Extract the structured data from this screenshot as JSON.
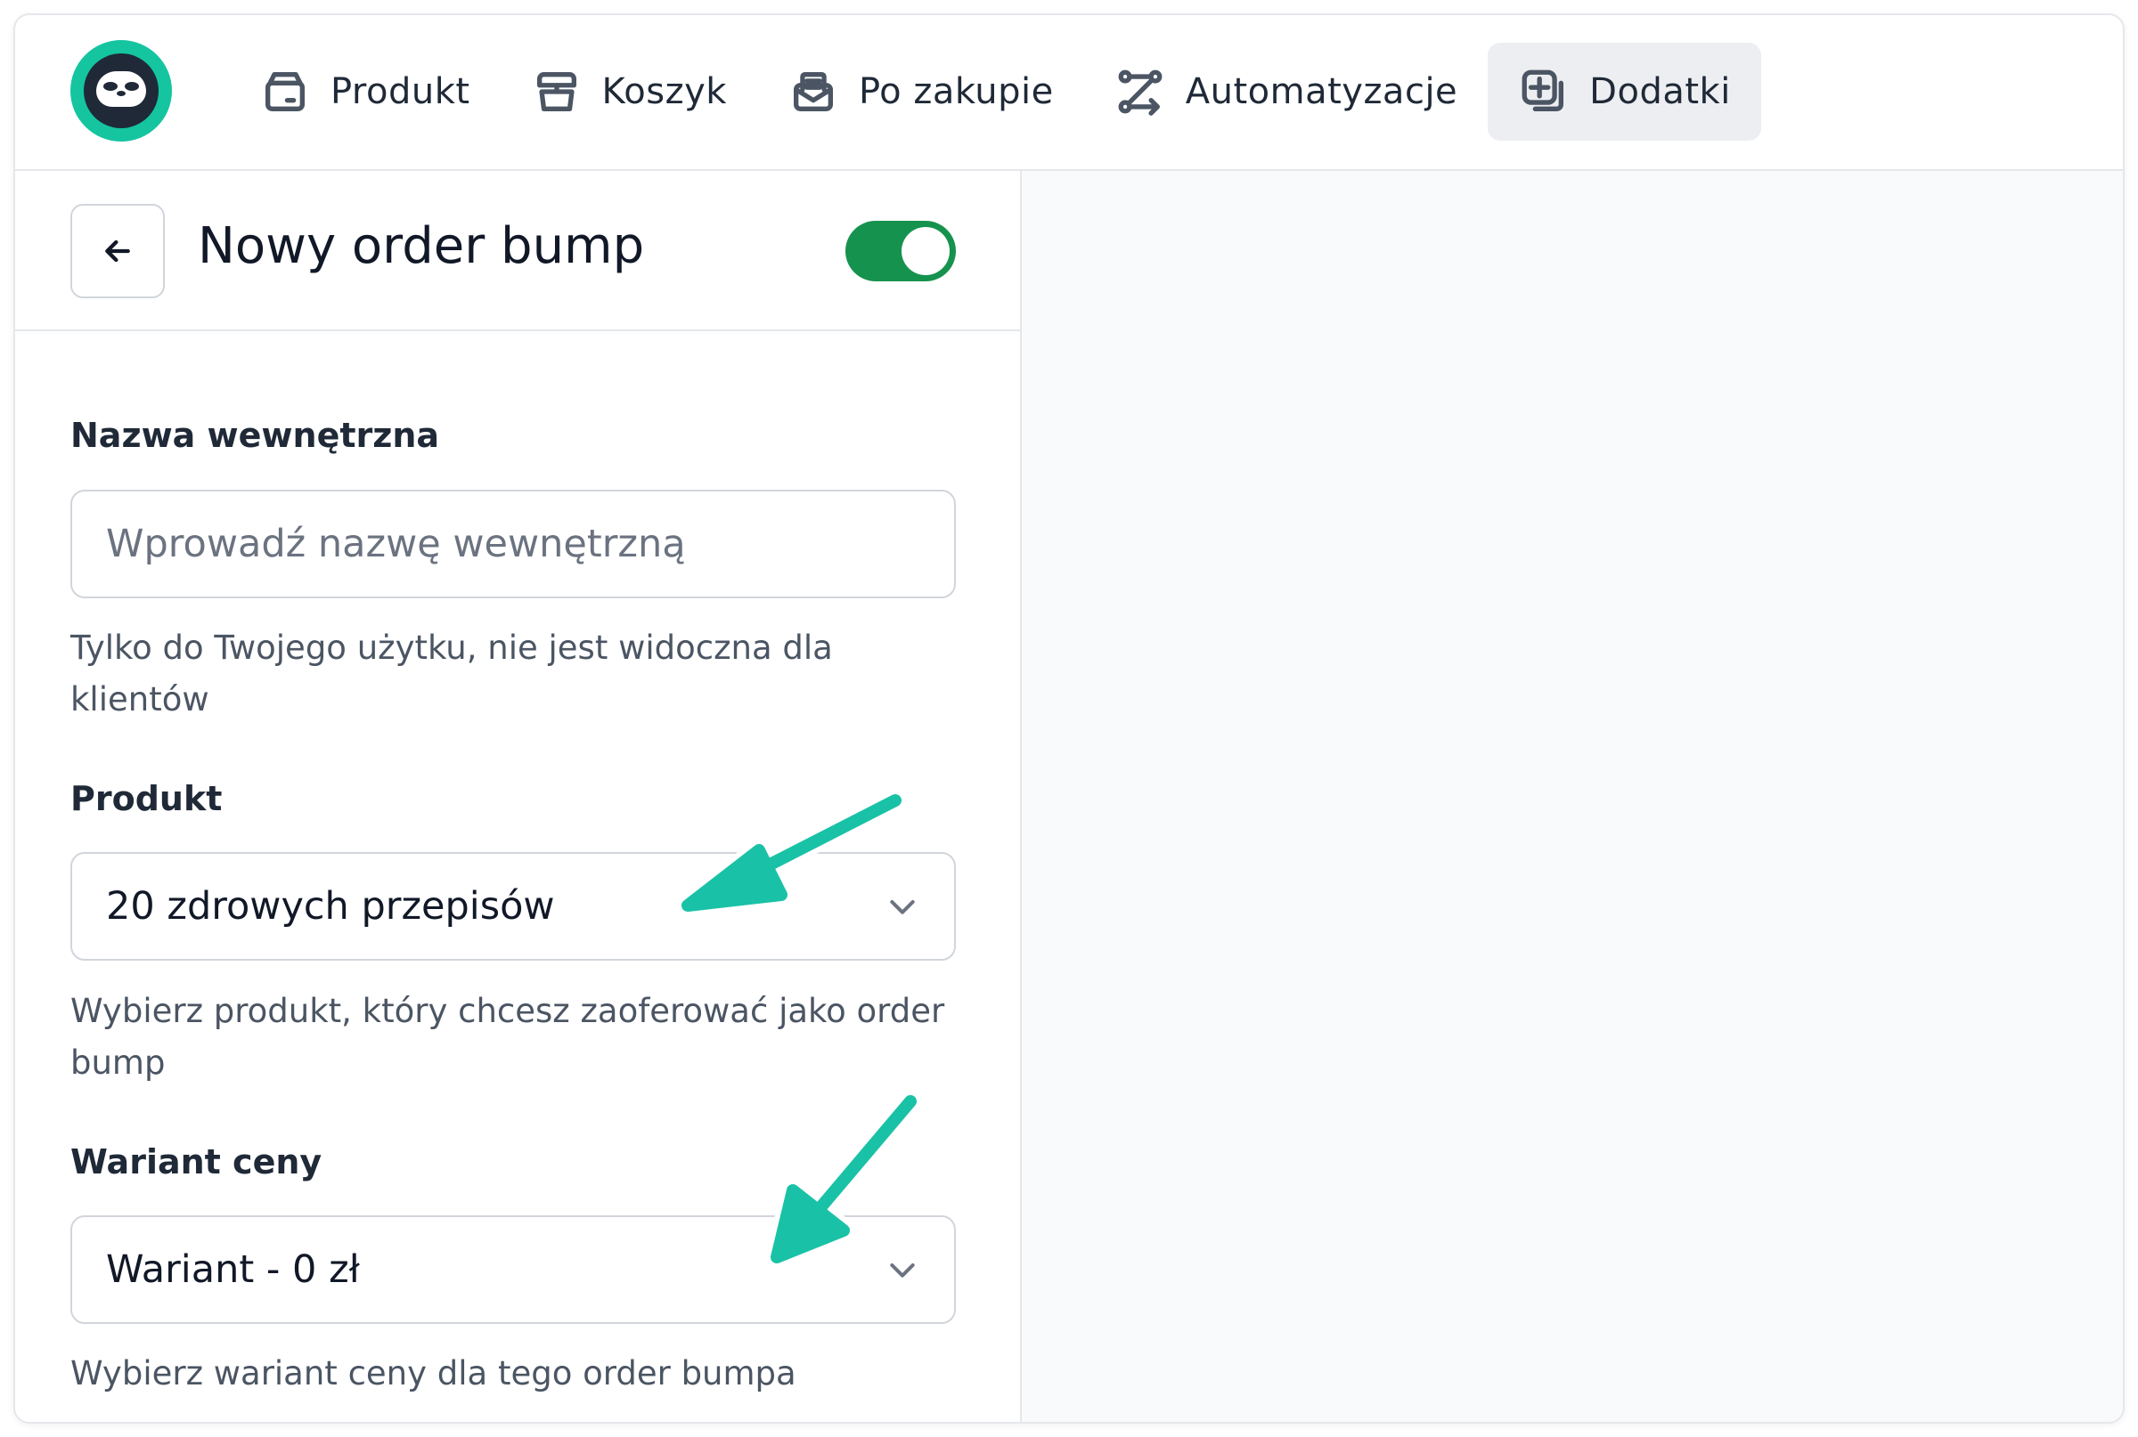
{
  "nav": {
    "items": [
      {
        "label": "Produkt",
        "icon": "box-icon"
      },
      {
        "label": "Koszyk",
        "icon": "cart-stack-icon"
      },
      {
        "label": "Po zakupie",
        "icon": "mail-open-icon"
      },
      {
        "label": "Automatyzacje",
        "icon": "route-icon"
      },
      {
        "label": "Dodatki",
        "icon": "add-stack-icon",
        "active": true
      }
    ]
  },
  "header": {
    "title": "Nowy order bump",
    "toggle_enabled": true
  },
  "form": {
    "internal_name": {
      "label": "Nazwa wewnętrzna",
      "placeholder": "Wprowadź nazwę wewnętrzną",
      "value": "",
      "help": "Tylko do Twojego użytku, nie jest widoczna dla klientów"
    },
    "product": {
      "label": "Produkt",
      "selected": "20 zdrowych przepisów",
      "help": "Wybierz produkt, który chcesz zaoferować jako order bump"
    },
    "price_variant": {
      "label": "Wariant ceny",
      "selected": "Wariant - 0 zł",
      "help": "Wybierz wariant ceny dla tego order bumpa"
    }
  },
  "colors": {
    "accent": "#14c5a0",
    "toggle_on": "#16924f",
    "annotation_arrow": "#19c2a6"
  }
}
